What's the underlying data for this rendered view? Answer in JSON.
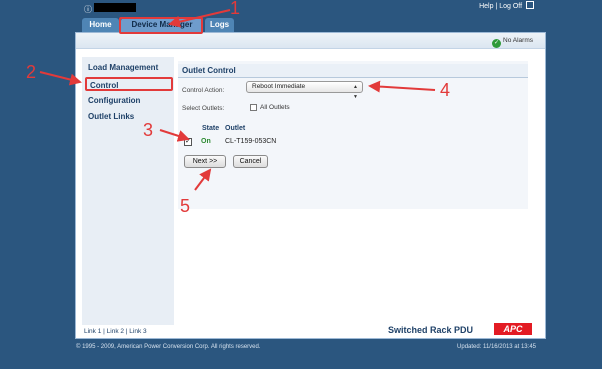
{
  "header": {
    "info_icon": "info-icon",
    "help_links": "Help | Log Off",
    "tabs": [
      {
        "label": "Home"
      },
      {
        "label": "Device Manager"
      },
      {
        "label": "Logs"
      }
    ]
  },
  "status": {
    "alarms": "No Alarms"
  },
  "sidebar": {
    "items": [
      {
        "label": "Load Management"
      },
      {
        "label": "Control"
      },
      {
        "label": "Configuration"
      },
      {
        "label": "Outlet Links"
      }
    ]
  },
  "outlet_control": {
    "title": "Outlet Control",
    "control_action_label": "Control Action:",
    "control_action_value": "Reboot Immediate",
    "select_outlets_label": "Select Outlets:",
    "all_outlets_label": "All Outlets",
    "col_state": "State",
    "col_outlet": "Outlet",
    "rows": [
      {
        "state": "On",
        "outlet": "CL-T159-053CN",
        "checked": true
      }
    ],
    "next_button": "Next >>",
    "cancel_button": "Cancel"
  },
  "footer": {
    "links": "Link 1 | Link 2 | Link 3",
    "product": "Switched Rack PDU",
    "logo": "APC",
    "copyright": "© 1995 - 2009, American Power Conversion Corp. All rights reserved.",
    "updated": "Updated: 11/16/2013 at 13:45"
  },
  "annotations": [
    "1",
    "2",
    "3",
    "4",
    "5"
  ],
  "colors": {
    "background": "#2b567f",
    "annotation": "#e23a3a",
    "state_on": "#2b8a2f",
    "logo": "#e31b23"
  }
}
